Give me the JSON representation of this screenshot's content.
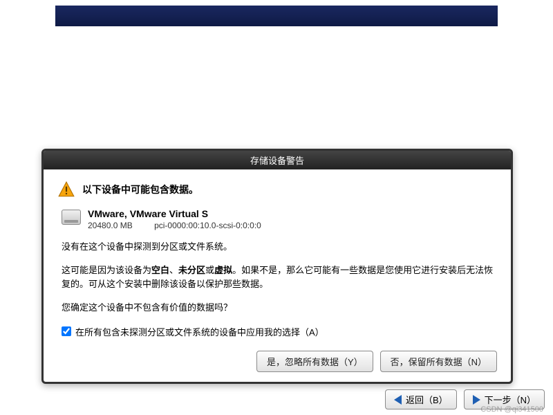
{
  "dialog": {
    "title": "存储设备警告",
    "warning_heading": "以下设备中可能包含数据。",
    "device": {
      "name": "VMware, VMware Virtual S",
      "size": "20480.0 MB",
      "path": "pci-0000:00:10.0-scsi-0:0:0:0"
    },
    "message1": "没有在这个设备中探测到分区或文件系统。",
    "message2_html": "这可能是因为该设备为<b>空白</b>、<b>未分区</b>或<b>虚拟</b>。如果不是，那么它可能有一些数据是您使用它进行安装后无法恢复的。可从这个安装中删除该设备以保护那些数据。",
    "message3": "您确定这个设备中不包含有价值的数据吗？",
    "checkbox_label": "在所有包含未探测分区或文件系统的设备中应用我的选择（A）",
    "checkbox_checked": true,
    "buttons": {
      "yes": "是，忽略所有数据（Y）",
      "no": "否，保留所有数据（N）"
    }
  },
  "nav": {
    "back": "返回（B）",
    "next": "下一步（N）"
  },
  "watermark": "CSDN @qi341500"
}
